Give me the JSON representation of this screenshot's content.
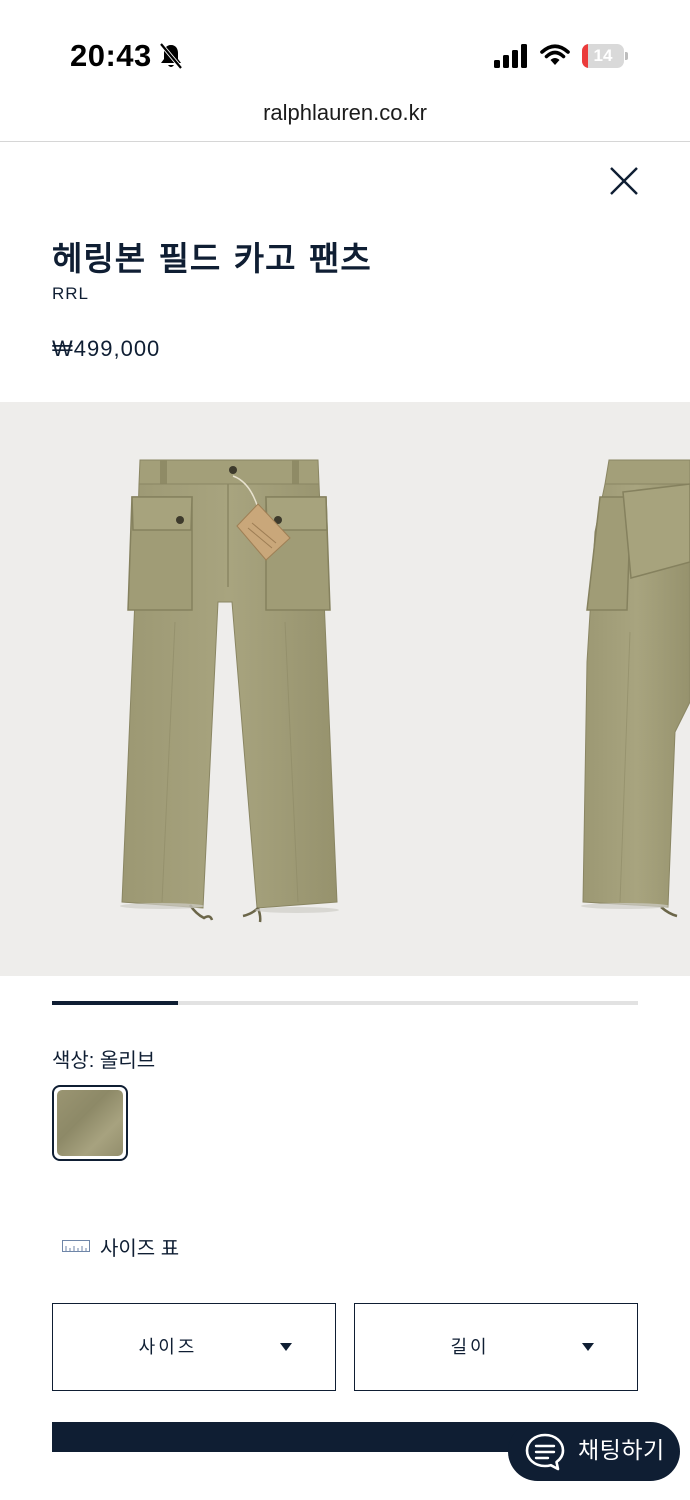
{
  "status_bar": {
    "time": "20:43",
    "battery_level": "14",
    "battery_fraction": 0.14,
    "battery_color": "#eb3b3b",
    "icons": [
      "bell-slash-icon",
      "cellular-signal-icon",
      "wifi-icon",
      "battery-icon"
    ]
  },
  "browser": {
    "url": "ralphlauren.co.kr"
  },
  "product": {
    "title": "헤링본 필드 카고 팬츠",
    "brand": "RRL",
    "price": "₩499,000"
  },
  "gallery": {
    "background": "#eeedeb",
    "progress_fraction": 0.215
  },
  "color": {
    "label": "색상: 올리브",
    "swatch_color": "#938e6c"
  },
  "size_chart": {
    "label": "사이즈 표",
    "icon": "ruler-icon"
  },
  "selectors": {
    "size_label": "사이즈",
    "length_label": "길이"
  },
  "chat": {
    "label": "채팅하기",
    "icon": "chat-bubble-icon"
  },
  "colors": {
    "navy": "#0f1e33",
    "pants_olive": "#a29e78"
  }
}
